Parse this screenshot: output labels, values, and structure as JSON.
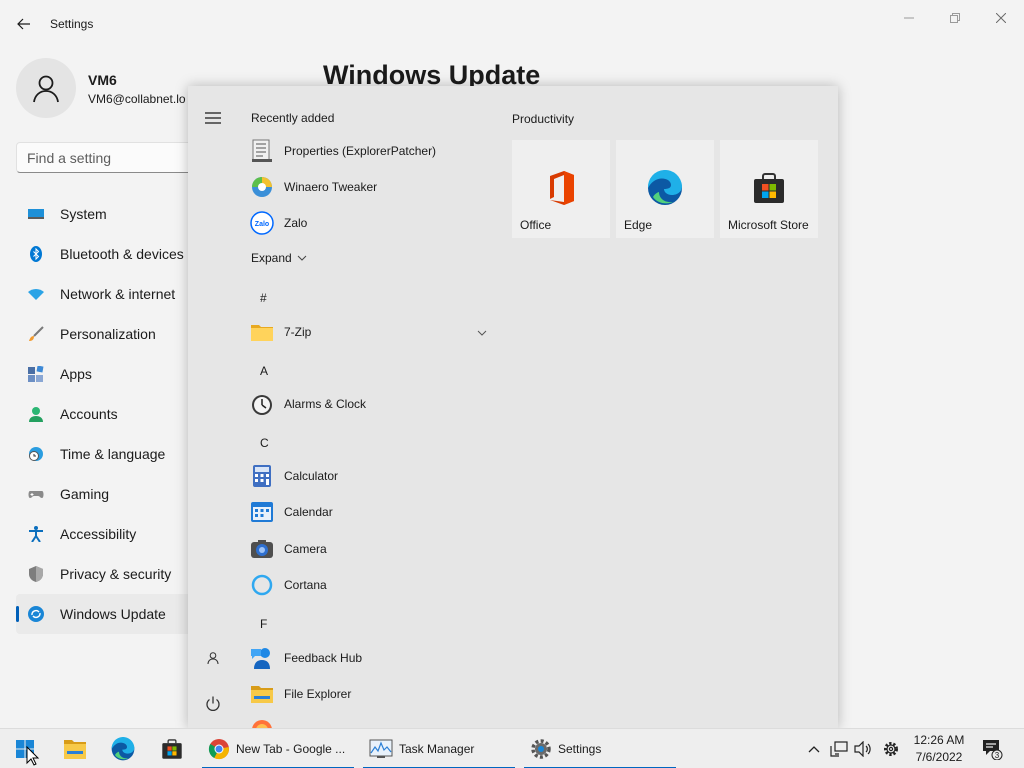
{
  "window": {
    "title": "Settings"
  },
  "profile": {
    "name": "VM6",
    "email": "VM6@collabnet.lo"
  },
  "search": {
    "placeholder": "Find a setting"
  },
  "nav": [
    {
      "label": "System"
    },
    {
      "label": "Bluetooth & devices"
    },
    {
      "label": "Network & internet"
    },
    {
      "label": "Personalization"
    },
    {
      "label": "Apps"
    },
    {
      "label": "Accounts"
    },
    {
      "label": "Time & language"
    },
    {
      "label": "Gaming"
    },
    {
      "label": "Accessibility"
    },
    {
      "label": "Privacy & security"
    },
    {
      "label": "Windows Update"
    }
  ],
  "main": {
    "page_title": "Windows Update"
  },
  "start_menu": {
    "recently_added_label": "Recently added",
    "recent_apps": [
      {
        "label": "Properties (ExplorerPatcher)"
      },
      {
        "label": "Winaero Tweaker"
      },
      {
        "label": "Zalo"
      }
    ],
    "expand_label": "Expand",
    "letters": [
      "#",
      "A",
      "C",
      "F"
    ],
    "apps": [
      {
        "label": "7-Zip"
      },
      {
        "label": "Alarms & Clock"
      },
      {
        "label": "Calculator"
      },
      {
        "label": "Calendar"
      },
      {
        "label": "Camera"
      },
      {
        "label": "Cortana"
      },
      {
        "label": "Feedback Hub"
      },
      {
        "label": "File Explorer"
      }
    ],
    "icons": {
      "zalo": "Zalo"
    },
    "productivity_label": "Productivity",
    "tiles": [
      {
        "label": "Office"
      },
      {
        "label": "Edge"
      },
      {
        "label": "Microsoft Store"
      }
    ]
  },
  "taskbar": {
    "tasks": [
      {
        "label": "New Tab - Google ..."
      },
      {
        "label": "Task Manager"
      },
      {
        "label": "Settings"
      }
    ],
    "time": "12:26 AM",
    "date": "7/6/2022",
    "notification_count": "3"
  },
  "colors": {
    "accent": "#0067c0",
    "active_indicator": "#005fb8"
  }
}
